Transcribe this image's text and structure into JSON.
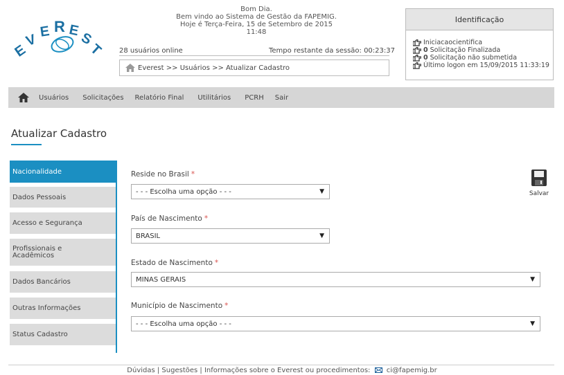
{
  "header": {
    "logo_text": "EVEREST",
    "welcome_lines": [
      "Bom Dia.",
      "Bem vindo ao Sistema de Gestão da FAPEMIG.",
      "Hoje é Terça-Feira, 15 de Setembro de 2015",
      "11:48"
    ],
    "users_online": "28 usuários online",
    "session_remaining": "Tempo restante da sessão: 00:23:37",
    "breadcrumb": {
      "root": "Everest",
      "rest": " >> Usuários >> Atualizar Cadastro"
    }
  },
  "identification": {
    "title": "Identificação",
    "username": "Iniciacaocientifica",
    "finalized_count": "0",
    "finalized_label": "Solicitação Finalizada",
    "unsubmitted_count": "0",
    "unsubmitted_label": "Solicitação não submetida",
    "last_logon": "Último logon em 15/09/2015 11:33:19"
  },
  "menu": {
    "items": [
      "Usuários",
      "Solicitações",
      "Relatório Final",
      "Utilitários",
      "PCRH",
      "Sair"
    ]
  },
  "page": {
    "title": "Atualizar Cadastro"
  },
  "sidebar": {
    "items": [
      {
        "label": "Nacionalidade",
        "active": true
      },
      {
        "label": "Dados Pessoais",
        "active": false
      },
      {
        "label": "Acesso e Segurança",
        "active": false
      },
      {
        "label": "Profissionais e Acadêmicos",
        "active": false
      },
      {
        "label": "Dados Bancários",
        "active": false
      },
      {
        "label": "Outras Informações",
        "active": false
      },
      {
        "label": "Status Cadastro",
        "active": false
      }
    ]
  },
  "form": {
    "required_mark": "*",
    "reside_label": "Reside no Brasil",
    "reside_value": "- - - Escolha uma opção - - -",
    "pais_label": "País de Nascimento",
    "pais_value": "BRASIL",
    "estado_label": "Estado de Nascimento",
    "estado_value": "MINAS GERAIS",
    "municipio_label": "Município de Nascimento",
    "municipio_value": "- - - Escolha uma opção - - -",
    "save_label": "Salvar"
  },
  "footer": {
    "text": "Dúvidas | Sugestões | Informações sobre o Everest ou procedimentos:",
    "email": "ci@fapemig.br"
  },
  "colors": {
    "accent": "#1b8fc2",
    "menu_bg": "#d6d6d6",
    "required": "#d9534f"
  }
}
